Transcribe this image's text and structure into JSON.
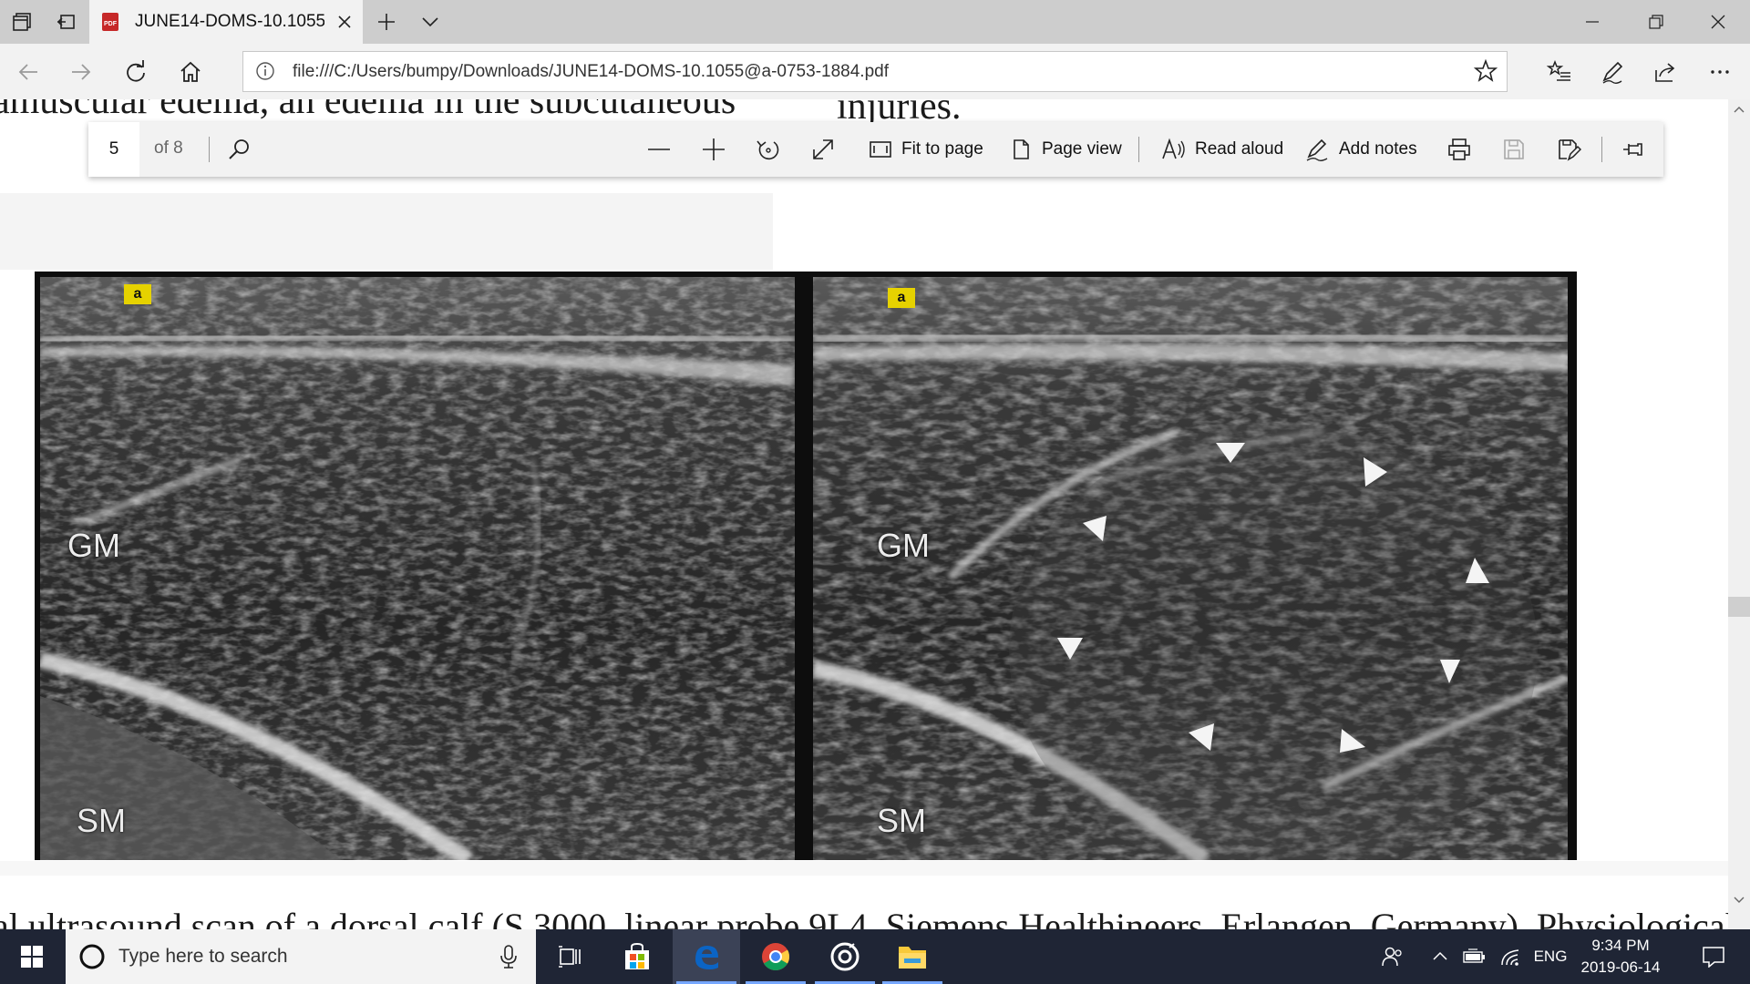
{
  "browser": {
    "tab_title": "JUNE14-DOMS-10.1055",
    "url": "file:///C:/Users/bumpy/Downloads/JUNE14-DOMS-10.1055@a-0753-1884.pdf"
  },
  "pdf_toolbar": {
    "page_number": "5",
    "page_count": "of 8",
    "fit_to_page": "Fit to page",
    "page_view": "Page view",
    "read_aloud": "Read aloud",
    "add_notes": "Add notes"
  },
  "document": {
    "top_left_text": "amuscular edema, an edema in the subcutaneous",
    "top_right_text": "injuries.",
    "bottom_text": "al ultrasound scan of a dorsal calf (S 3000, linear probe 9L4, Siemens Healthineers, Erlangen, Germany). Physiological"
  },
  "figure": {
    "left_panel": {
      "letter": "a",
      "label_top": "GM",
      "label_bottom": "SM"
    },
    "right_panel": {
      "letter": "a",
      "label_top": "GM",
      "label_bottom": "SM"
    }
  },
  "taskbar": {
    "search_placeholder": "Type here to search",
    "language": "ENG",
    "time": "9:34 PM",
    "date": "2019-06-14"
  },
  "colors": {
    "tabbar_bg": "#cdcdcd",
    "toolbar_bg": "#f2f2f2",
    "taskbar_bg": "#1f2535",
    "panel_letter_bg": "#e6d200",
    "edge_accent": "#0b64c4"
  }
}
